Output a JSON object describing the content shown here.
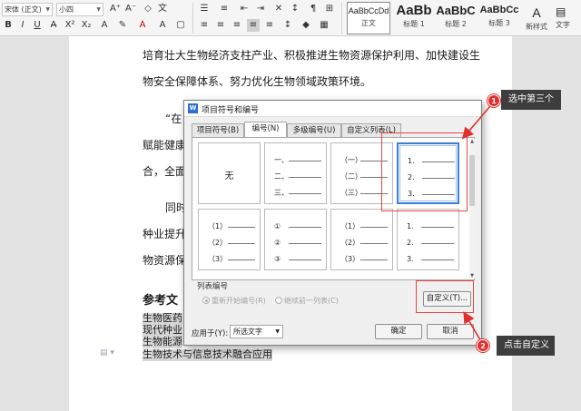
{
  "ribbon": {
    "font_name": "宋体 (正文)",
    "font_size": "小四",
    "styles": [
      {
        "sample": "AaBbCcDd",
        "name": "正文"
      },
      {
        "sample": "AaBb",
        "name": "标题 1"
      },
      {
        "sample": "AaBbC",
        "name": "标题 2"
      },
      {
        "sample": "AaBbCc",
        "name": "标题 3"
      }
    ],
    "new_style_label": "新样式",
    "text_tool_label": "文字"
  },
  "document": {
    "line1": "培育壮大生物经济支柱产业、积极推进生物资源保护利用、加快建设生",
    "line2": "物安全保障体系、努力优化生物领域政策环境。",
    "line3": "“在",
    "line4": "赋能健康",
    "line5": "合，全面",
    "line6": "同时",
    "line7": "种业提升",
    "line8": "物资源保",
    "heading": "参考文",
    "list_items": [
      "生物医药",
      "现代种业",
      "生物能源",
      "生物技术与信息技术融合应用"
    ]
  },
  "dialog": {
    "title": "项目符号和编号",
    "tabs": [
      "项目符号(B)",
      "编号(N)",
      "多级编号(U)",
      "自定义列表(L)"
    ],
    "active_tab": 1,
    "none_label": "无",
    "cells": [
      {
        "markers": []
      },
      {
        "markers": [
          "一、",
          "二、",
          "三、"
        ]
      },
      {
        "markers": [
          "（一）",
          "（二）",
          "（三）"
        ]
      },
      {
        "markers": [
          "1.",
          "2.",
          "3."
        ]
      },
      {
        "markers": [
          "（1）",
          "（2）",
          "（3）"
        ]
      },
      {
        "markers": [
          "①",
          "②",
          "③"
        ]
      },
      {
        "markers": [
          "（1）",
          "（2）",
          "（3）"
        ]
      },
      {
        "markers": [
          "1.",
          "2.",
          "3."
        ]
      }
    ],
    "list_numbering_label": "列表编号",
    "restart_label": "重新开始编号(R)",
    "continue_label": "继续前一列表(C)",
    "customize_label": "自定义(T)...",
    "apply_to_label": "应用于(Y):",
    "apply_to_value": "所选文字",
    "ok_label": "确定",
    "cancel_label": "取消"
  },
  "annotations": {
    "badge1": "1",
    "callout1": "选中第三个",
    "badge2": "2",
    "callout2": "点击自定义",
    "color": "#e0302d"
  }
}
